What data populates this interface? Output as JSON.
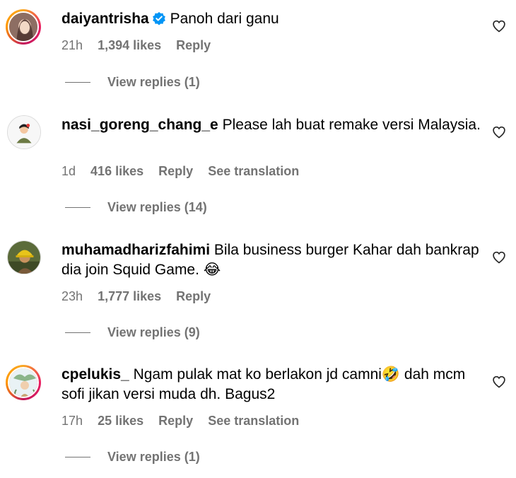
{
  "comments": [
    {
      "username": "daiyantrisha",
      "verified": true,
      "text": "Panoh dari ganu",
      "time": "21h",
      "likes": "1,394 likes",
      "reply": "Reply",
      "translation": "",
      "view_replies": "View replies (1)"
    },
    {
      "username": "nasi_goreng_chang_e",
      "verified": false,
      "text": "Please lah buat remake versi Malaysia.",
      "time": "1d",
      "likes": "416 likes",
      "reply": "Reply",
      "translation": "See translation",
      "view_replies": "View replies (14)"
    },
    {
      "username": "muhamadharizfahimi",
      "verified": false,
      "text": "Bila business burger Kahar dah bankrap dia join Squid Game. 😂",
      "time": "23h",
      "likes": "1,777 likes",
      "reply": "Reply",
      "translation": "",
      "view_replies": "View replies (9)"
    },
    {
      "username": "cpelukis_",
      "verified": false,
      "text": "Ngam pulak mat ko berlakon jd camni🤣 dah mcm sofi jikan versi muda dh. Bagus2",
      "time": "17h",
      "likes": "25 likes",
      "reply": "Reply",
      "translation": "See translation",
      "view_replies": "View replies (1)"
    }
  ],
  "colors": {
    "secondary_text": "#737373",
    "verified_blue": "#0095f6"
  },
  "icons": {
    "like": "heart-icon",
    "verified": "verified-badge-icon"
  }
}
